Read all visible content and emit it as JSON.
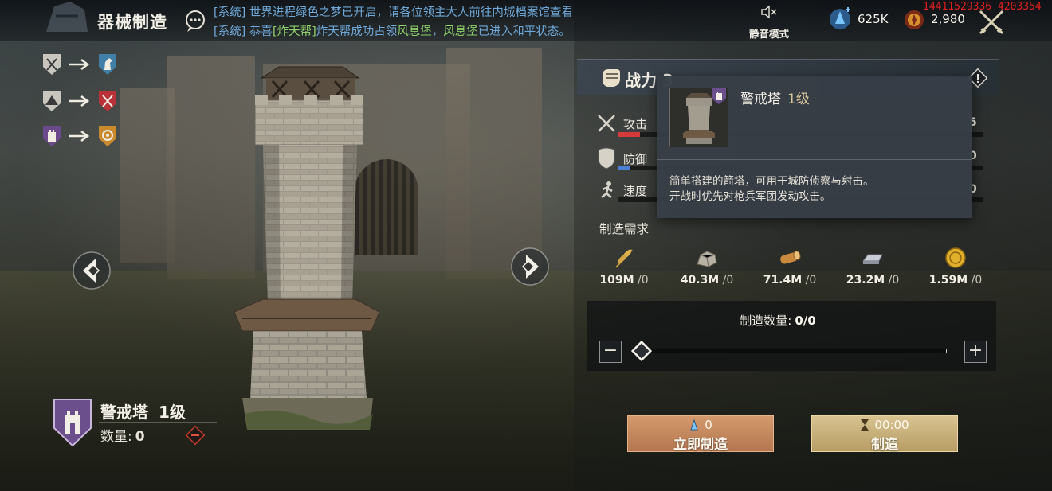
{
  "topbar": {
    "title": "器械制造",
    "messages": [
      {
        "prefix": "[系统]",
        "text": " 世界进程绿色之梦已开启，请各位领主大人前往内城档案馆查看"
      },
      {
        "prefix": "[系统]",
        "part1": " 恭喜",
        "guild_tag": "[炸天帮]",
        "part2": "炸天帮成功占领",
        "place1": "风息堡",
        "part3": "，",
        "place2": "风息堡",
        "part4": "已进入和平状态。"
      }
    ],
    "mute_label": "静音模式",
    "gems": "625K",
    "gold": "2,980",
    "debug_id": "14411529336 4203354"
  },
  "counters": [
    {
      "from_icon": "crossed-swords-badge",
      "to_icon": "horse-badge"
    },
    {
      "from_icon": "tent-badge",
      "to_icon": "crossed-blades-badge"
    },
    {
      "from_icon": "tower-badge",
      "to_icon": "target-badge"
    }
  ],
  "unit": {
    "name": "警戒塔",
    "level": "1级",
    "count_label": "数量:",
    "count_value": "0"
  },
  "panel": {
    "power_label": "战力 3",
    "stats": [
      {
        "label": "攻击",
        "value": "5",
        "fill": 0.06,
        "color": "#d43a3a"
      },
      {
        "label": "防御",
        "value": "0",
        "fill": 0.03,
        "color": "#4a7fd4"
      },
      {
        "label": "速度",
        "value": "0",
        "fill": 0.0,
        "color": "#d4d4d4"
      }
    ],
    "requirement_title": "制造需求",
    "requirements": [
      {
        "icon": "wheat-icon",
        "value": "109M",
        "need": " /0"
      },
      {
        "icon": "stone-icon",
        "value": "40.3M",
        "need": " /0"
      },
      {
        "icon": "wood-icon",
        "value": "71.4M",
        "need": " /0"
      },
      {
        "icon": "iron-icon",
        "value": "23.2M",
        "need": " /0"
      },
      {
        "icon": "gold-coin-icon",
        "value": "1.59M",
        "need": " /0"
      }
    ],
    "quantity_label": "制造数量:",
    "quantity_value": "0/0",
    "minus": "−",
    "plus": "+",
    "instant_cost": "0",
    "instant_label": "立即制造",
    "build_time": "00:00",
    "build_label": "制造"
  },
  "tooltip": {
    "title": "警戒塔",
    "level": "1级",
    "desc_line1": "简单搭建的箭塔，可用于城防侦察与射击。",
    "desc_line2": "开战时优先对枪兵军团发动攻击。"
  }
}
